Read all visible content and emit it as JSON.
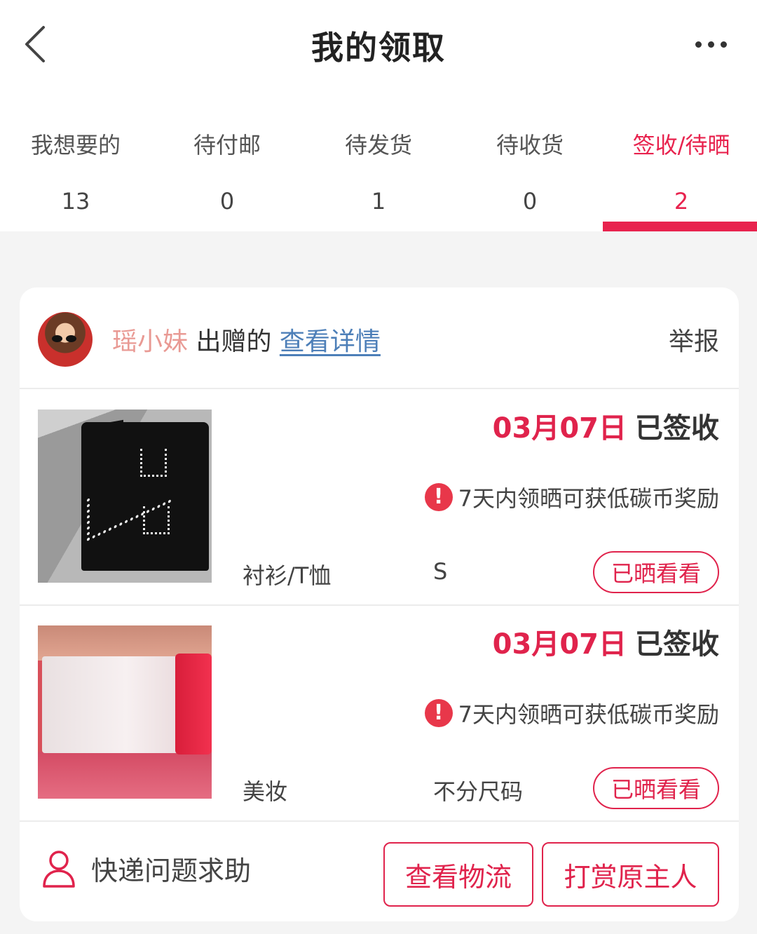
{
  "header": {
    "title": "我的领取",
    "back_icon": "chevron-left-icon",
    "more_icon": "ellipsis-icon"
  },
  "tabs": [
    {
      "label": "我想要的",
      "count": "13",
      "active": false
    },
    {
      "label": "待付邮",
      "count": "0",
      "active": false
    },
    {
      "label": "待发货",
      "count": "1",
      "active": false
    },
    {
      "label": "待收货",
      "count": "0",
      "active": false
    },
    {
      "label": "签收/待晒",
      "count": "2",
      "active": true
    }
  ],
  "card": {
    "giver_name": "瑶小妹",
    "giver_suffix": " 出赠的 ",
    "details_link": "查看详情",
    "report": "举报",
    "items": [
      {
        "date": "03月07日",
        "status": "已签收",
        "notice": "7天内领晒可获低碳币奖励",
        "category": "衬衫/T恤",
        "size": "S",
        "button": "已晒看看"
      },
      {
        "date": "03月07日",
        "status": "已签收",
        "notice": "7天内领晒可获低碳币奖励",
        "category": "美妆",
        "size": "不分尺码",
        "button": "已晒看看"
      }
    ],
    "footer": {
      "help": "快递问题求助",
      "logistics": "查看物流",
      "tip": "打赏原主人"
    }
  },
  "colors": {
    "accent": "#e0234c",
    "link": "#4d7fb8",
    "giver_name": "#e99a94"
  }
}
